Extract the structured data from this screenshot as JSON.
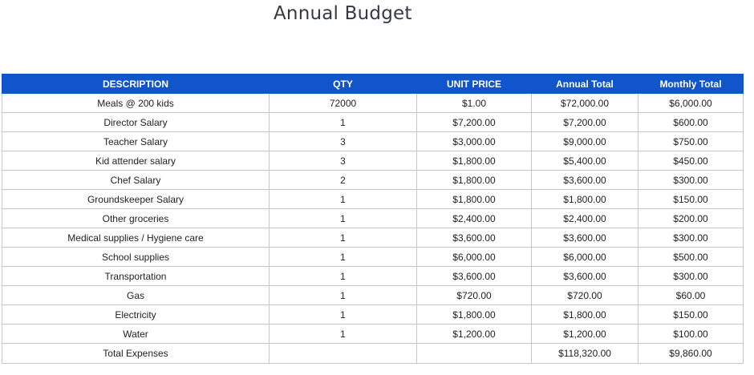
{
  "page": {
    "title": "Annual Budget"
  },
  "table": {
    "headers": [
      "DESCRIPTION",
      "QTY",
      "UNIT PRICE",
      "Annual Total",
      "Monthly Total"
    ],
    "rows": [
      [
        "Meals @ 200 kids",
        "72000",
        "$1.00",
        "$72,000.00",
        "$6,000.00"
      ],
      [
        "Director Salary",
        "1",
        "$7,200.00",
        "$7,200.00",
        "$600.00"
      ],
      [
        "Teacher Salary",
        "3",
        "$3,000.00",
        "$9,000.00",
        "$750.00"
      ],
      [
        "Kid attender salary",
        "3",
        "$1,800.00",
        "$5,400.00",
        "$450.00"
      ],
      [
        "Chef Salary",
        "2",
        "$1,800.00",
        "$3,600.00",
        "$300.00"
      ],
      [
        "Groundskeeper Salary",
        "1",
        "$1,800.00",
        "$1,800.00",
        "$150.00"
      ],
      [
        "Other groceries",
        "1",
        "$2,400.00",
        "$2,400.00",
        "$200.00"
      ],
      [
        "Medical supplies / Hygiene care",
        "1",
        "$3,600.00",
        "$3,600.00",
        "$300.00"
      ],
      [
        "School supplies",
        "1",
        "$6,000.00",
        "$6,000.00",
        "$500.00"
      ],
      [
        "Transportation",
        "1",
        "$3,600.00",
        "$3,600.00",
        "$300.00"
      ],
      [
        "Gas",
        "1",
        "$720.00",
        "$720.00",
        "$60.00"
      ],
      [
        "Electricity",
        "1",
        "$1,800.00",
        "$1,800.00",
        "$150.00"
      ],
      [
        "Water",
        "1",
        "$1,200.00",
        "$1,200.00",
        "$100.00"
      ],
      [
        "Total Expenses",
        "",
        "",
        "$118,320.00",
        "$9,860.00"
      ]
    ]
  },
  "colors": {
    "header_bg": "#1155cc",
    "header_text": "#ffffff",
    "grid_line": "#c8c8c8",
    "title_text": "#333a44"
  }
}
